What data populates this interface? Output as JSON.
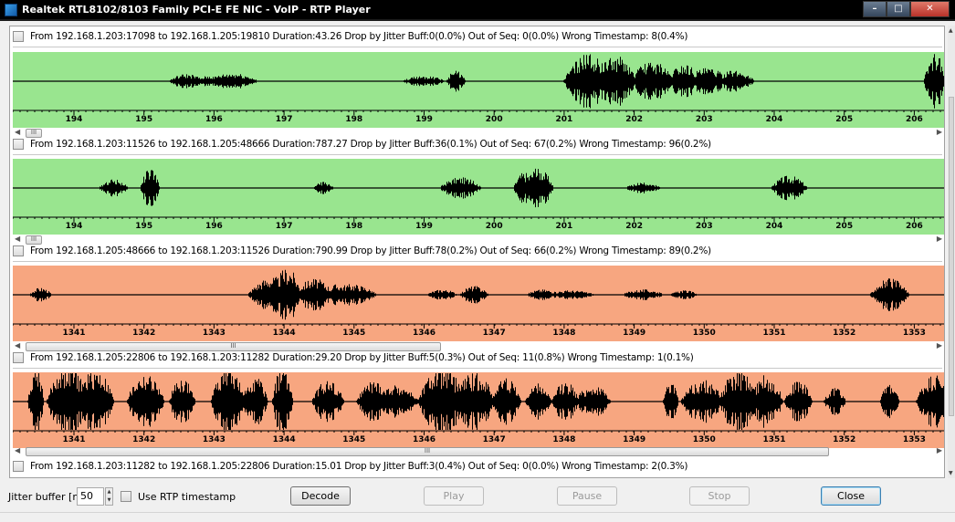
{
  "window": {
    "title": "Realtek RTL8102/8103 Family PCI-E FE NIC - VoIP - RTP Player"
  },
  "streams": [
    {
      "header": "From 192.168.1.203:17098 to 192.168.1.205:19810   Duration:43.26   Drop by Jitter Buff:0(0.0%)   Out of Seq: 0(0.0%)   Wrong Timestamp: 8(0.4%)",
      "color": "#99e58f",
      "ticks": [
        "194",
        "195",
        "196",
        "197",
        "198",
        "199",
        "200",
        "201",
        "202",
        "203",
        "204",
        "205",
        "206"
      ]
    },
    {
      "header": "From 192.168.1.203:11526 to 192.168.1.205:48666   Duration:787.27   Drop by Jitter Buff:36(0.1%)   Out of Seq: 67(0.2%)   Wrong Timestamp: 96(0.2%)",
      "color": "#99e58f",
      "ticks": [
        "194",
        "195",
        "196",
        "197",
        "198",
        "199",
        "200",
        "201",
        "202",
        "203",
        "204",
        "205",
        "206"
      ]
    },
    {
      "header": "From 192.168.1.205:48666 to 192.168.1.203:11526   Duration:790.99   Drop by Jitter Buff:78(0.2%)   Out of Seq: 66(0.2%)   Wrong Timestamp: 89(0.2%)",
      "color": "#f7a680",
      "ticks": [
        "1341",
        "1342",
        "1343",
        "1344",
        "1345",
        "1346",
        "1347",
        "1348",
        "1349",
        "1350",
        "1351",
        "1352",
        "1353"
      ]
    },
    {
      "header": "From 192.168.1.205:22806 to 192.168.1.203:11282   Duration:29.20   Drop by Jitter Buff:5(0.3%)   Out of Seq: 11(0.8%)   Wrong Timestamp: 1(0.1%)",
      "color": "#f7a680",
      "ticks": [
        "1341",
        "1342",
        "1343",
        "1344",
        "1345",
        "1346",
        "1347",
        "1348",
        "1349",
        "1350",
        "1351",
        "1352",
        "1353"
      ]
    },
    {
      "header": "From 192.168.1.203:11282 to 192.168.1.205:22806   Duration:15.01   Drop by Jitter Buff:3(0.4%)   Out of Seq: 0(0.0%)   Wrong Timestamp: 2(0.3%)"
    }
  ],
  "controls": {
    "jitter_label": "Jitter buffer [ms]",
    "jitter_value": "50",
    "use_rtp_label": "Use RTP timestamp",
    "decode": "Decode",
    "play": "Play",
    "pause": "Pause",
    "stop": "Stop",
    "close": "Close"
  },
  "scroll_glyph": "III"
}
